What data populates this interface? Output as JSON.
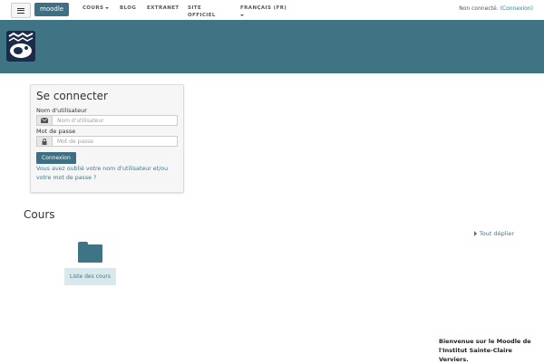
{
  "topbar": {
    "brand": "moodle",
    "nav": [
      {
        "label": "COURS",
        "dropdown": true
      },
      {
        "label": "BLOG",
        "dropdown": false
      },
      {
        "label": "EXTRANET",
        "dropdown": false
      },
      {
        "label": "SITE OFFICIEL",
        "dropdown": false
      },
      {
        "label": "FRANÇAIS (FR)",
        "dropdown": true
      }
    ],
    "login_status_text": "Non connecté.",
    "login_link": "(Connexion)"
  },
  "colors": {
    "header_bg": "#3f7484",
    "brand_bg": "#3f6f83",
    "link": "#3f7a8c",
    "course_button_bg": "#d9e8eb"
  },
  "login": {
    "title": "Se connecter",
    "username_label": "Nom d'utilisateur",
    "username_placeholder": "Nom d'utilisateur",
    "username_icon": "envelope-icon",
    "password_label": "Mot de passe",
    "password_placeholder": "Mot de passe",
    "password_icon": "lock-icon",
    "submit_label": "Connexion",
    "forgot_link": "Vous avez oublié votre nom d'utilisateur et/ou votre mot de passe ?"
  },
  "courses": {
    "title": "Cours",
    "expand_all": "Tout déplier",
    "list_button": "Liste des cours"
  },
  "footer": {
    "welcome": "Bienvenue sur le Moodle de l'Institut Sainte-Claire Verviers."
  }
}
